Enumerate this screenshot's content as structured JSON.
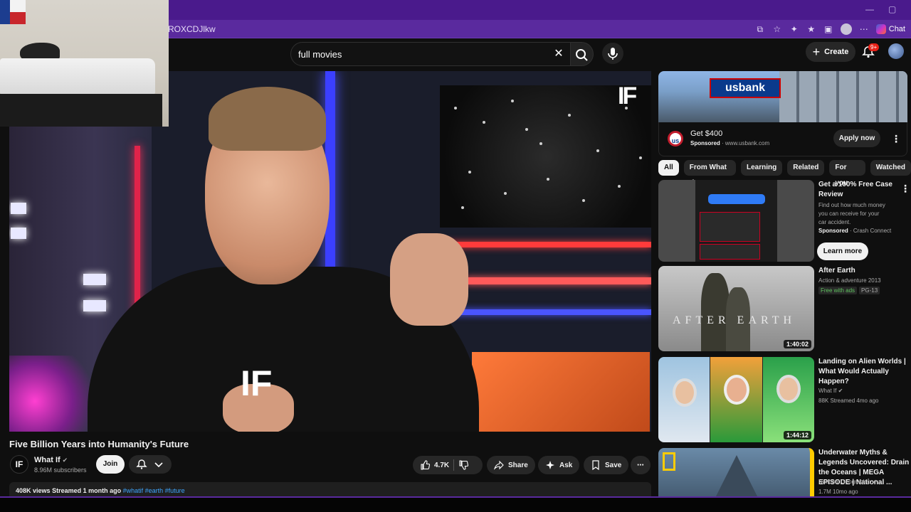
{
  "browser": {
    "url": "ROXCDJlkw",
    "chat_label": "Chat",
    "min_glyph": "—",
    "restore_glyph": "▢"
  },
  "search": {
    "query": "full movies"
  },
  "topbar": {
    "create_label": "Create",
    "notifications_badge": "9+"
  },
  "video": {
    "title": "Five Billion Years into Humanity's Future",
    "overlay_logo": "IF",
    "shirt_logo": "IF",
    "channel": {
      "initials": "IF",
      "name": "What If",
      "subscribers": "8.96M subscribers",
      "join_label": "Join"
    },
    "actions": {
      "likes": "4.7K",
      "share": "Share",
      "ask": "Ask",
      "save": "Save"
    },
    "stats": {
      "views": "408K views",
      "streamed": "Streamed 1 month ago",
      "tags": "#whatif #earth #future"
    }
  },
  "ad": {
    "sign_text": "usbank",
    "logo_text": "us",
    "title": "Get $400",
    "sponsored": "Sponsored",
    "domain": "www.usbank.com",
    "cta": "Apply now"
  },
  "chips": [
    "All",
    "From What If",
    "Learning",
    "Related",
    "For you",
    "Watched"
  ],
  "recommendations": [
    {
      "title": "Get a 100% Free Case Review",
      "desc": "Find out how much money you can receive for your car accident.",
      "sponsored": "Sponsored",
      "advertiser": "Crash Connect",
      "cta": "Learn more"
    },
    {
      "title": "After Earth",
      "line1": "Action & adventure 2013",
      "badge_free": "Free with ads",
      "badge_rating": "PG-13",
      "duration": "1:40:02",
      "thumb_text": "AFTER EARTH"
    },
    {
      "title": "Landing on Alien Worlds | What Would Actually Happen?",
      "channel": "What If",
      "meta": "88K  Streamed 4mo ago",
      "duration": "1:44:12"
    },
    {
      "title": "Underwater Myths & Legends Uncovered: Drain the Oceans | MEGA EPISODE | National ...",
      "channel": "National Geographic",
      "meta": "1.7M  10mo ago"
    }
  ]
}
